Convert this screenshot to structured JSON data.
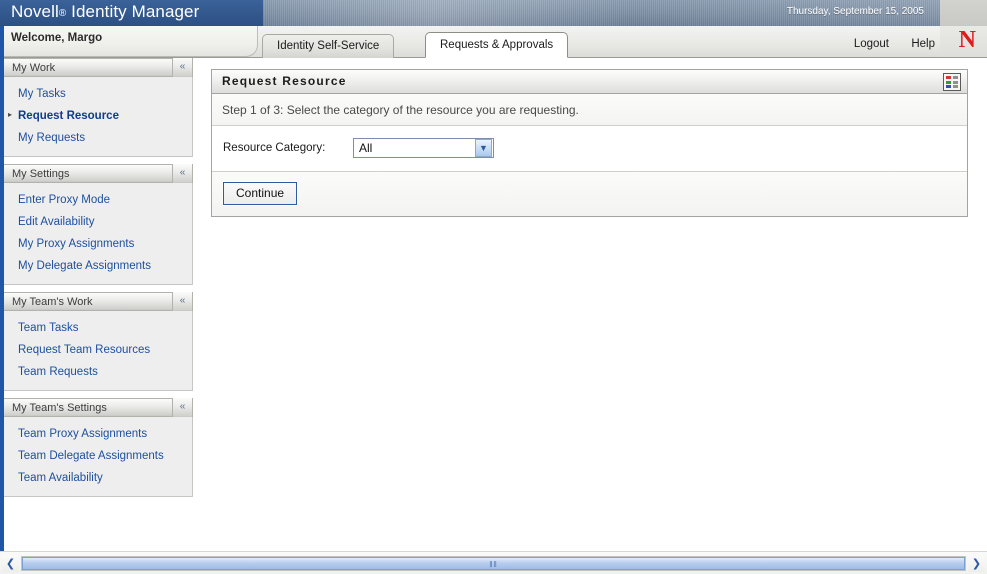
{
  "banner": {
    "title": "Novell",
    "title_reg": "®",
    "title_product": "Identity Manager",
    "date": "Thursday, September 15, 2005",
    "logo": "novell-n-logo",
    "logo_letter": "N",
    "accent_blue": "#32578c",
    "logo_red": "#e01b1b"
  },
  "header": {
    "welcome": "Welcome, Margo",
    "tabs": [
      {
        "label": "Identity Self-Service",
        "active": false
      },
      {
        "label": "Requests & Approvals",
        "active": true
      }
    ],
    "links": [
      {
        "label": "Logout"
      },
      {
        "label": "Help"
      }
    ]
  },
  "sidebar": {
    "groups": [
      {
        "title": "My Work",
        "collapse_icon": "«",
        "items": [
          {
            "label": "My Tasks",
            "current": false
          },
          {
            "label": "Request Resource",
            "current": true
          },
          {
            "label": "My Requests",
            "current": false
          }
        ]
      },
      {
        "title": "My Settings",
        "collapse_icon": "«",
        "items": [
          {
            "label": "Enter Proxy Mode",
            "current": false
          },
          {
            "label": "Edit Availability",
            "current": false
          },
          {
            "label": "My Proxy Assignments",
            "current": false
          },
          {
            "label": "My Delegate Assignments",
            "current": false
          }
        ]
      },
      {
        "title": "My Team's Work",
        "collapse_icon": "«",
        "items": [
          {
            "label": "Team Tasks",
            "current": false
          },
          {
            "label": "Request Team Resources",
            "current": false
          },
          {
            "label": "Team Requests",
            "current": false
          }
        ]
      },
      {
        "title": "My Team's Settings",
        "collapse_icon": "«",
        "items": [
          {
            "label": "Team Proxy Assignments",
            "current": false
          },
          {
            "label": "Team Delegate Assignments",
            "current": false
          },
          {
            "label": "Team Availability",
            "current": false
          }
        ]
      }
    ]
  },
  "panel": {
    "title": "Request Resource",
    "header_icon": "color-legend-grid-icon",
    "step_text": "Step 1 of 3: Select the category of the resource you are requesting.",
    "form": {
      "label": "Resource Category:",
      "select_value": "All",
      "select_options": [
        "All"
      ],
      "select_arrow_icon": "chevron-down-icon"
    },
    "continue_label": "Continue"
  },
  "scrollbar": {
    "left_arrow": "❮",
    "right_arrow": "❯",
    "grip": "‖‖"
  }
}
